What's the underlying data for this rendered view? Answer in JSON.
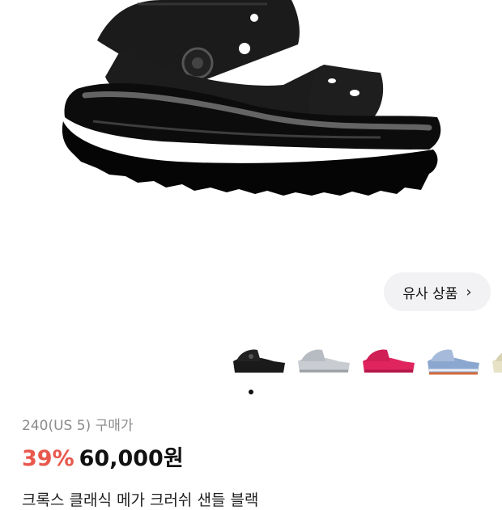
{
  "product": {
    "similar_label": "유사 상품",
    "variant": "240(US 5) 구매가",
    "discount": "39%",
    "price": "60,000원",
    "name": "크록스 클래식 메가 크러쉬 샌들 블랙"
  },
  "icons": {
    "similar_chevron": "chevron-right-icon"
  },
  "thumbnails": [
    {
      "color": "#1a1a1a",
      "label": "black"
    },
    {
      "color": "#c9cdd2",
      "label": "gray"
    },
    {
      "color": "#e0245e",
      "label": "pink"
    },
    {
      "color": "#8ca7cf",
      "label": "blue"
    },
    {
      "color": "#e7e2c6",
      "label": "cream"
    }
  ]
}
